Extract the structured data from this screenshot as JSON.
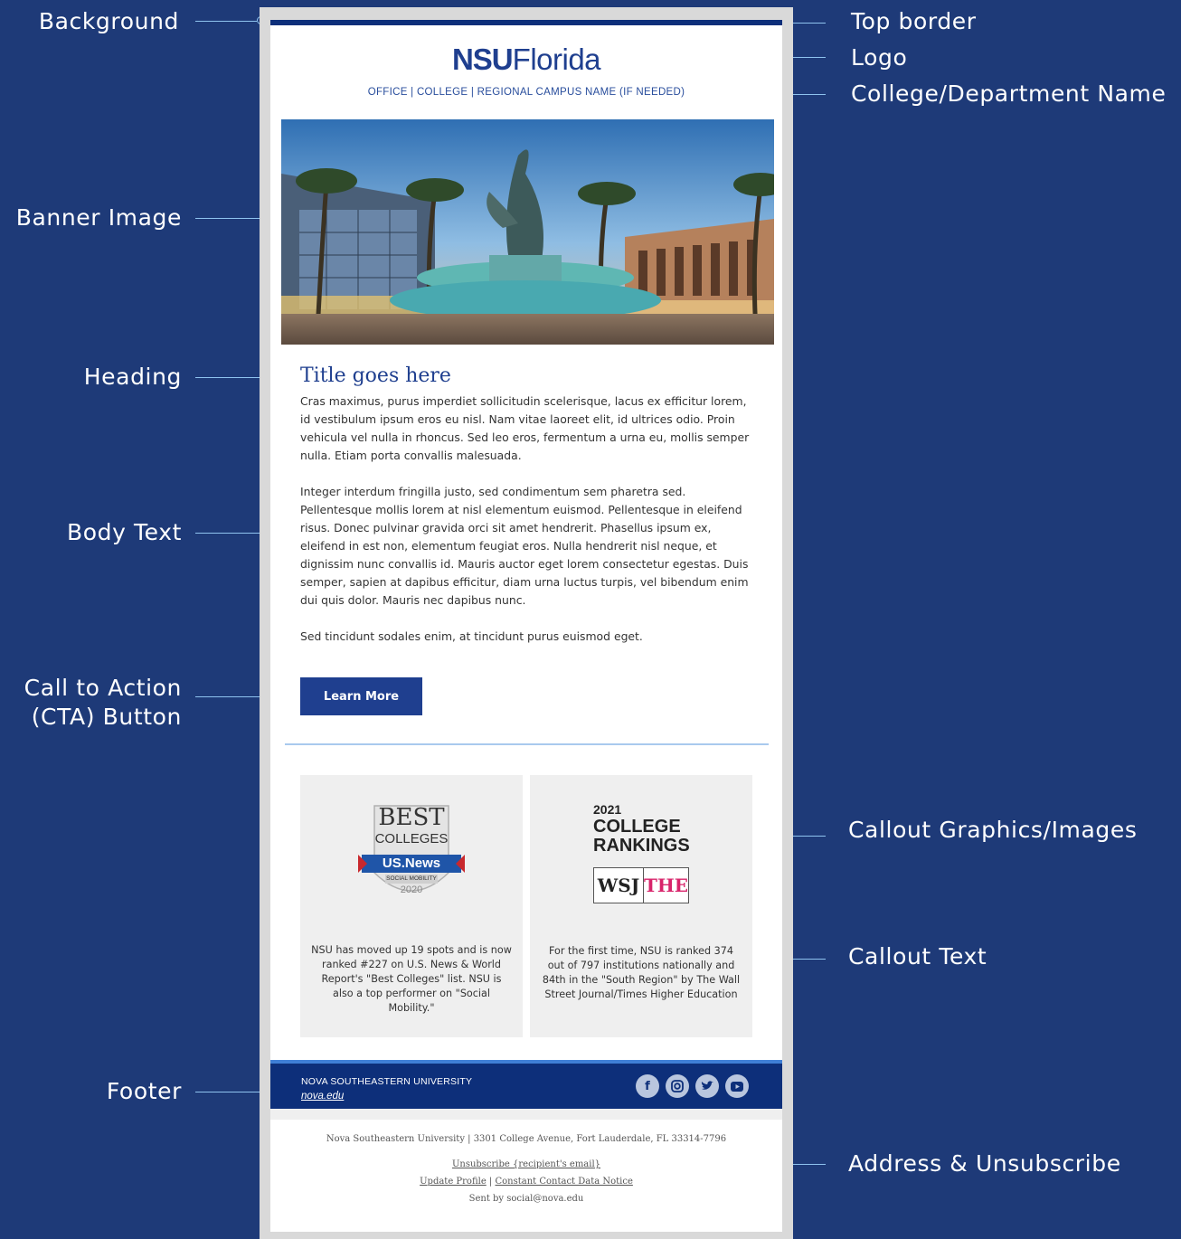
{
  "annotations": {
    "background": "Background",
    "banner_image": "Banner Image",
    "heading": "Heading",
    "body_text": "Body Text",
    "cta_line1": "Call to Action",
    "cta_line2": "(CTA) Button",
    "footer": "Footer",
    "top_border": "Top border",
    "logo": "Logo",
    "college_department_name": "College/Department Name",
    "callout_graphics": "Callout Graphics/Images",
    "callout_text": "Callout Text",
    "address_unsubscribe": "Address & Unsubscribe"
  },
  "email": {
    "logo_bold": "NSU",
    "logo_light": "Florida",
    "department": "OFFICE | COLLEGE | REGIONAL CAMPUS NAME (IF NEEDED)",
    "title": "Title goes here",
    "paragraphs": [
      "Cras maximus, purus imperdiet sollicitudin scelerisque, lacus ex efficitur lorem, id vestibulum ipsum eros eu nisl. Nam vitae laoreet elit, id ultrices odio. Proin vehicula vel nulla in rhoncus. Sed leo eros, fermentum a urna eu, mollis semper nulla. Etiam porta convallis malesuada.",
      "Integer interdum fringilla justo, sed condimentum sem pharetra sed. Pellentesque mollis lorem at nisl elementum euismod. Pellentesque in eleifend risus. Donec pulvinar gravida orci sit amet hendrerit. Phasellus ipsum ex, eleifend in est non, elementum feugiat eros. Nulla hendrerit nisl neque, et dignissim nunc convallis id. Mauris auctor eget lorem consectetur egestas. Duis semper, sapien at dapibus efficitur, diam urna luctus turpis, vel bibendum enim dui quis dolor. Mauris nec dapibus nunc.",
      "Sed tincidunt sodales enim, at tincidunt purus euismod eget."
    ],
    "cta_label": "Learn More",
    "callout_left": {
      "badge_best": "BEST",
      "badge_colleges": "COLLEGES",
      "badge_usnews": "US.News",
      "badge_sub": "SOCIAL MOBILITY",
      "badge_year": "2020",
      "text": "NSU has moved up 19 spots and is now ranked #227 on U.S. News & World Report's \"Best Colleges\" list. NSU is also a top performer on \"Social Mobility.\""
    },
    "callout_right": {
      "year": "2021",
      "line1": "COLLEGE",
      "line2": "RANKINGS",
      "logo_wsj": "WSJ",
      "logo_the": "THE",
      "text": "For the first time, NSU is ranked 374 out of 797 institutions nationally and 84th in the \"South Region\" by The Wall Street Journal/Times Higher Education"
    },
    "footer": {
      "org": "NOVA SOUTHEASTERN UNIVERSITY",
      "link": "nova.edu",
      "social_icons": [
        "facebook-icon",
        "instagram-icon",
        "twitter-icon",
        "youtube-icon"
      ]
    },
    "address": "Nova Southeastern University | 3301 College Avenue, Fort Lauderdale, FL 33314-7796",
    "unsubscribe": "Unsubscribe {recipient's email}",
    "update_profile": "Update Profile",
    "separator": "|",
    "data_notice": "Constant Contact Data Notice",
    "sent_by": "Sent by social@nova.edu"
  },
  "colors": {
    "background": "#1e3a78",
    "leader": "#8fc3ef",
    "brand_blue": "#1f3f8f",
    "footer_blue": "#0d2f7a"
  }
}
